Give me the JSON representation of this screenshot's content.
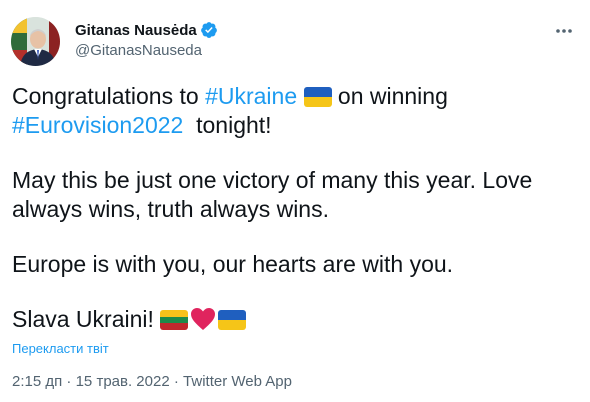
{
  "author": {
    "display_name": "Gitanas Nausėda",
    "handle": "@GitanasNauseda",
    "verified": true,
    "avatar_icon": "user-avatar-portrait"
  },
  "tweet": {
    "p1_prefix": "Congratulations to ",
    "hashtag_ukraine": "#Ukraine",
    "p1_middle": " on winning",
    "hashtag_eurovision": "#Eurovision2022",
    "p1_suffix": "  tonight!",
    "p2": "May this be just one victory of many this year. Love always wins, truth always wins.",
    "p3": "Europe is with you, our hearts are with you.",
    "p4": "Slava Ukraini! ",
    "emoji": [
      "flag-ukraine",
      "flag-lithuania",
      "red-heart"
    ]
  },
  "translate_link": "Перекласти твіт",
  "meta": {
    "time": "2:15 дп",
    "separator": " · ",
    "date": "15 трав. 2022",
    "source": "Twitter Web App"
  },
  "colors": {
    "link": "#1d9bf0",
    "text": "#0f1419",
    "secondary": "#536471"
  }
}
